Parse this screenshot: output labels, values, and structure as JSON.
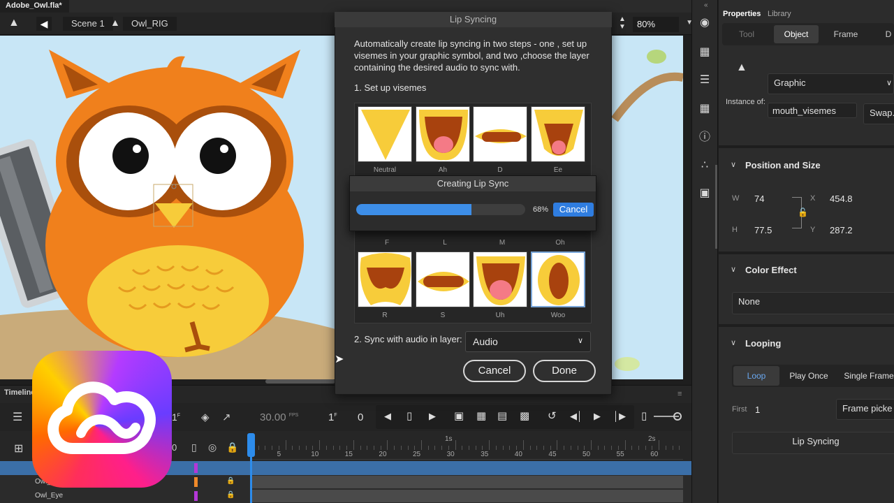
{
  "document": {
    "tab_title": "Adobe_Owl.fla*"
  },
  "scene_bar": {
    "scene": "Scene 1",
    "symbol": "Owl_RIG",
    "zoom": "80%"
  },
  "lip_sync_dialog": {
    "title": "Lip Syncing",
    "description": "Automatically create lip syncing in two steps - one , set up visemes in your graphic symbol, and two ,choose the layer containing the desired audio to sync with.",
    "step1_label": "1. Set up visemes",
    "visemes": [
      "Neutral",
      "Ah",
      "D",
      "Ee",
      "F",
      "L",
      "M",
      "Oh",
      "R",
      "S",
      "Uh",
      "Woo"
    ],
    "step2_label": "2. Sync with audio in layer:",
    "audio_layer": "Audio",
    "cancel_label": "Cancel",
    "done_label": "Done"
  },
  "progress": {
    "title": "Creating Lip Sync",
    "percent_text": "68%",
    "fraction": 0.68,
    "cancel_label": "Cancel"
  },
  "timeline": {
    "title": "Timeline",
    "fps": "30.00",
    "fps_unit": "FPS",
    "frame": "1",
    "frame_unit": "F",
    "frame_offset": "0",
    "frame_field_left": "1",
    "frame_field_left_unit": "F",
    "counter_left": "0",
    "second_markers": [
      "1s",
      "2s"
    ],
    "frame_ticks": [
      "5",
      "10",
      "15",
      "20",
      "25",
      "30",
      "35",
      "40",
      "45",
      "50",
      "55",
      "60"
    ],
    "layers": [
      "Owl_",
      "Owl_Eye"
    ]
  },
  "properties": {
    "tabs": [
      "Properties",
      "Library"
    ],
    "sub_tabs": [
      "Tool",
      "Object",
      "Frame",
      "D"
    ],
    "symbol_type": "Graphic",
    "instance_of_label": "Instance of:",
    "instance_name": "mouth_visemes",
    "swap_label": "Swap...",
    "position_size": {
      "title": "Position and Size",
      "w_label": "W",
      "w": "74",
      "h_label": "H",
      "h": "77.5",
      "x_label": "X",
      "x": "454.8",
      "y_label": "Y",
      "y": "287.2"
    },
    "color_effect": {
      "title": "Color Effect",
      "value": "None"
    },
    "looping": {
      "title": "Looping",
      "options": [
        "Loop",
        "Play Once",
        "Single Frame"
      ],
      "first_label": "First",
      "first_value": "1",
      "frame_picker_label": "Frame picke",
      "lip_sync_button": "Lip Syncing"
    }
  },
  "colors": {
    "accent_blue": "#2f7de0",
    "owl_orange": "#f0801c",
    "owl_brown": "#a94f0c",
    "owl_yellow": "#f7cc3a",
    "stage_sky": "#c8e6f6"
  }
}
